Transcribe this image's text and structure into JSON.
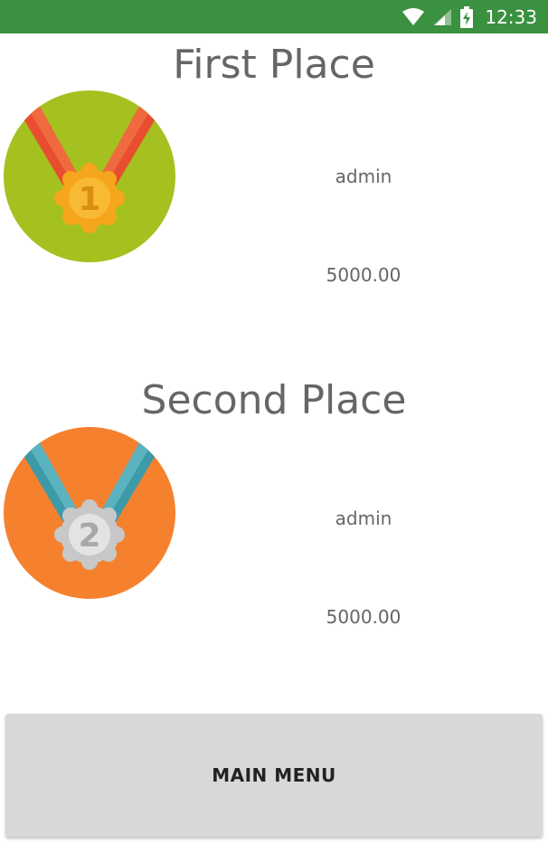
{
  "status_bar": {
    "time": "12:33",
    "background_color": "#3a9140",
    "icons": [
      "wifi-icon",
      "cell-signal-icon",
      "battery-charging-icon"
    ]
  },
  "first_place": {
    "title": "First Place",
    "medal_number": "1",
    "player": "admin",
    "score": "5000.00",
    "medal_background_color": "#a4c11f",
    "ribbon_color": "#e84d2f",
    "medal_color": "#f6a61c"
  },
  "second_place": {
    "title": "Second Place",
    "medal_number": "2",
    "player": "admin",
    "score": "5000.00",
    "medal_background_color": "#f5812f",
    "ribbon_color": "#4aa6b2",
    "medal_color": "#c8c8c8"
  },
  "main_menu_button": {
    "label": "MAIN MENU"
  }
}
